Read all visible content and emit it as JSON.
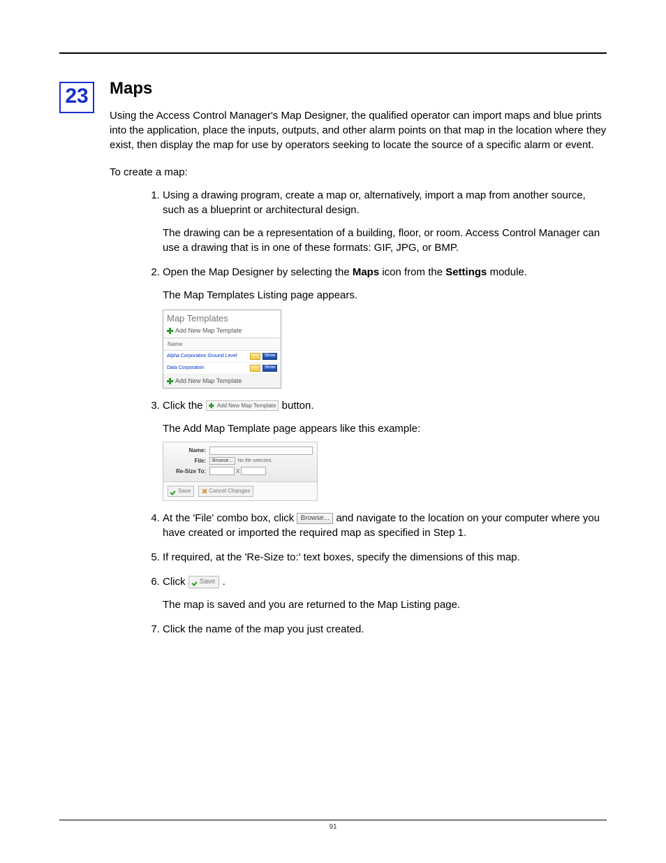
{
  "chapterNumber": "23",
  "title": "Maps",
  "intro": "Using the Access Control Manager's Map Designer, the qualified operator can import maps and blue prints into the application, place the inputs, outputs, and other alarm points on that map in the location where they exist, then display the map for use by operators seeking to locate the source of a specific alarm or event.",
  "lead": "To create a map:",
  "steps": {
    "s1": {
      "text": "Using a drawing program, create a map or, alternatively, import a map from another source, such as a blueprint or architectural design.",
      "sub": "The drawing can be a representation of a building, floor, or room. Access Control Manager can use a drawing that is in one of these formats: GIF, JPG, or BMP."
    },
    "s2": {
      "pre": "Open the Map Designer by selecting the ",
      "bold1": "Maps",
      "mid": " icon from the ",
      "bold2": "Settings",
      "post": " module.",
      "sub": "The Map Templates Listing page appears."
    },
    "s3": {
      "pre": "Click the ",
      "post": " button.",
      "sub": "The Add Map Template page appears like this example:"
    },
    "s4": {
      "pre": "At the 'File' combo box, click ",
      "post": " and navigate to the location on your computer where you have created or imported the required map as specified in Step 1."
    },
    "s5": "If required, at the 'Re-Size to:' text boxes, specify the dimensions of this map.",
    "s6": {
      "pre": "Click ",
      "post": ".",
      "sub": "The map is saved and you are returned to the Map Listing page."
    },
    "s7": "Click the name of the map you just created."
  },
  "mapTemplates": {
    "title": "Map Templates",
    "addLabel": "Add New Map Template",
    "headerName": "Name",
    "rows": [
      {
        "name": "Alpha Corporation Ground Level",
        "show": "Show"
      },
      {
        "name": "Data Corporation",
        "show": "Show"
      }
    ],
    "footLabel": "Add New Map Template"
  },
  "addMapTpl": {
    "nameLabel": "Name:",
    "fileLabel": "File:",
    "browse": "Browse...",
    "noFile": "No file selected.",
    "resizeLabel": "Re-Size To:",
    "x": "X",
    "save": "Save",
    "cancel": "Cancel Changes"
  },
  "inline": {
    "addNewMapTpl": "Add New Map Template",
    "browse": "Browse...",
    "save": "Save"
  },
  "pageNumber": "91"
}
